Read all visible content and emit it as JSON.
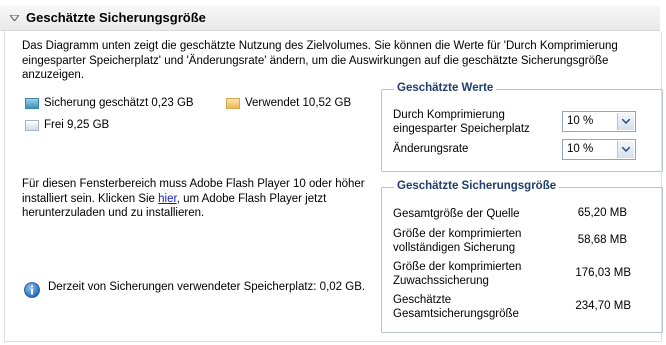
{
  "section_title": "Geschätzte Sicherungsgröße",
  "description": "Das Diagramm unten zeigt die geschätzte Nutzung des Zielvolumes. Sie können die Werte für 'Durch Komprimierung eingesparter Speicherplatz' und 'Änderungsrate' ändern, um die Auswirkungen auf die geschätzte Sicherungsgröße anzuzeigen.",
  "legend": {
    "backup_label": "Sicherung geschätzt 0,23 GB",
    "used_label": "Verwendet 10,52 GB",
    "free_label": "Frei 9,25 GB"
  },
  "colors": {
    "backup": "#4f9cc4",
    "used": "#f2c26a",
    "free": "#e4e9f1",
    "group_title": "#1f3e6e",
    "link": "#1020c0"
  },
  "flash": {
    "text_before": "Für diesen Fensterbereich muss Adobe Flash Player 10 oder höher installiert sein.  Klicken Sie ",
    "link": "hier",
    "text_after": ", um Adobe Flash Player jetzt herunterzuladen und zu installieren."
  },
  "info_text": "Derzeit von Sicherungen verwendeter Speicherplatz: 0,02 GB.",
  "estimates": {
    "title": "Geschätzte Werte",
    "compression_label": "Durch Komprimierung eingesparter Speicherplatz",
    "compression_value": "10 %",
    "change_rate_label": "Änderungsrate",
    "change_rate_value": "10 %"
  },
  "size_estimate": {
    "title": "Geschätzte Sicherungsgröße",
    "rows": [
      {
        "label": "Gesamtgröße der Quelle",
        "value": "65,20 MB"
      },
      {
        "label": "Größe der komprimierten vollständigen Sicherung",
        "value": "58,68 MB"
      },
      {
        "label": "Größe der komprimierten Zuwachssicherung",
        "value": "176,03 MB"
      },
      {
        "label": "Geschätzte Gesamtsicherungsgröße",
        "value": "234,70 MB"
      }
    ]
  }
}
